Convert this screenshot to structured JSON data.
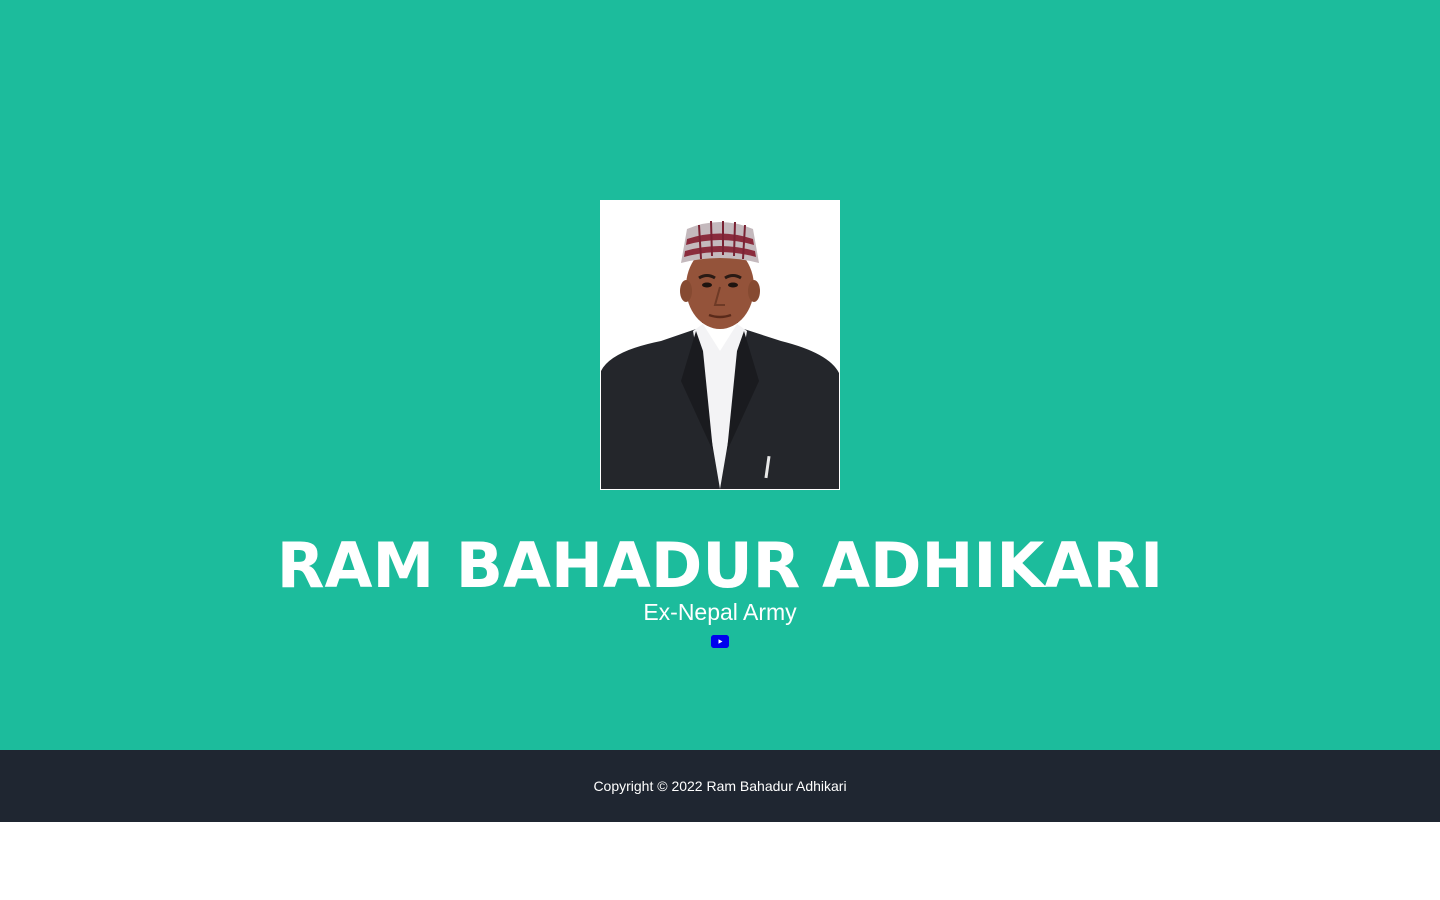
{
  "hero": {
    "background": "#1cbc9c",
    "name": "RAM BAHADUR ADHIKARI",
    "subtitle": "Ex-Nepal Army",
    "portrait_alt": "Ram Bahadur Adhikari",
    "social": {
      "icon": "youtube-icon",
      "color": "#0000ee"
    }
  },
  "footer": {
    "background": "#1f2631",
    "copyright": "Copyright © 2022 Ram Bahadur Adhikari"
  }
}
